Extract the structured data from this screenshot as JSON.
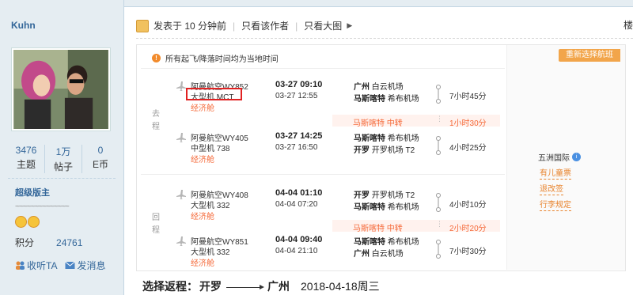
{
  "profile": {
    "username": "Kuhn",
    "stats": [
      {
        "value": "3476",
        "label": "主题"
      },
      {
        "value": "1万",
        "label": "帖子"
      },
      {
        "value": "0",
        "label": "E币"
      }
    ],
    "rank": "超级版主",
    "signature": "~~~~~~~~~~~~~~",
    "points_label": "积分",
    "points_value": "24761",
    "follow_label": "收听TA",
    "message_label": "发消息"
  },
  "post_header": {
    "posted": "发表于 10 分钟前",
    "only_author": "只看该作者",
    "only_big": "只看大图",
    "right_edge": "楼"
  },
  "notice": "所有起飞/降落时间均为当地时间",
  "sections": {
    "outbound_label": "去程",
    "return_label": "回程"
  },
  "flights": [
    {
      "airline": "阿曼航空WY852",
      "aircraft": "大型机 MCT",
      "cabin": "经济舱",
      "dep_time": "03-27 09:10",
      "arr_time": "03-27 12:55",
      "dep_city": "广州",
      "dep_airport": "白云机场",
      "arr_city": "马斯喀特",
      "arr_airport": "希布机场",
      "duration": "7小时45分"
    },
    {
      "airline": "阿曼航空WY405",
      "aircraft": "中型机 738",
      "cabin": "经济舱",
      "dep_time": "03-27 14:25",
      "arr_time": "03-27 16:50",
      "dep_city": "马斯喀特",
      "dep_airport": "希布机场",
      "arr_city": "开罗",
      "arr_airport": "开罗机场 T2",
      "duration": "4小时25分"
    },
    {
      "airline": "阿曼航空WY408",
      "aircraft": "大型机 332",
      "cabin": "经济舱",
      "dep_time": "04-04 01:10",
      "arr_time": "04-04 07:20",
      "dep_city": "开罗",
      "dep_airport": "开罗机场 T2",
      "arr_city": "马斯喀特",
      "arr_airport": "希布机场",
      "duration": "4小时10分"
    },
    {
      "airline": "阿曼航空WY851",
      "aircraft": "大型机 332",
      "cabin": "经济舱",
      "dep_time": "04-04 09:40",
      "arr_time": "04-04 21:10",
      "dep_city": "马斯喀特",
      "dep_airport": "希布机场",
      "arr_city": "广州",
      "arr_airport": "白云机场",
      "duration": "7小时30分"
    }
  ],
  "transfers": [
    {
      "place": "马斯喀特 中转",
      "time": "1小时30分"
    },
    {
      "place": "马斯喀特 中转",
      "time": "2小时20分"
    }
  ],
  "right_pane": {
    "rebook": "重新选择航班",
    "agency": "五洲国际",
    "links": [
      "有儿童票",
      "退改签",
      "行李规定"
    ]
  },
  "bottom": {
    "label": "选择返程：",
    "origin": "开罗",
    "destination": "广州",
    "date": "2018-04-18周三"
  },
  "colors": {
    "accent_orange": "#f56a3a",
    "link_blue": "#336699",
    "highlight_red": "#e12222"
  }
}
